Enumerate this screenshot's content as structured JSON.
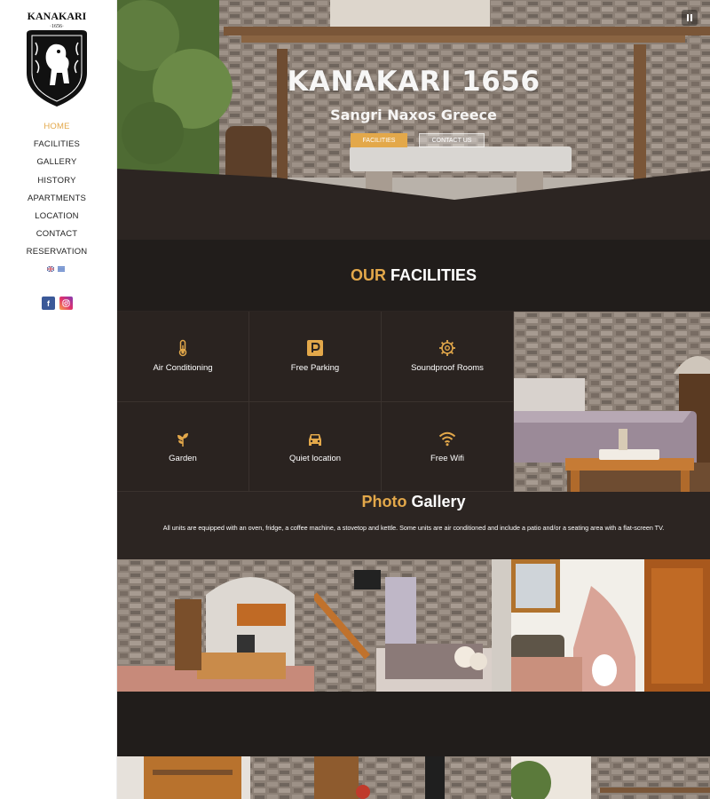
{
  "brand": {
    "logo_text": "KANAKARI",
    "logo_year": "1656"
  },
  "nav": {
    "items": [
      {
        "label": "HOME",
        "active": true
      },
      {
        "label": "FACILITIES"
      },
      {
        "label": "GALLERY"
      },
      {
        "label": "HISTORY"
      },
      {
        "label": "APARTMENTS"
      },
      {
        "label": "LOCATION"
      },
      {
        "label": "CONTACT"
      },
      {
        "label": "RESERVATION"
      }
    ]
  },
  "languages": [
    "english-flag",
    "greek-flag"
  ],
  "social": {
    "facebook": "f",
    "instagram_icon": "instagram-icon"
  },
  "hero": {
    "title": "KANAKARI 1656",
    "subtitle": "Sangri Naxos Greece",
    "button_facilities": "FACILITIES",
    "button_contact": "CONTACT US"
  },
  "facilities": {
    "title_accent": "OUR",
    "title_rest": " FACILITIES",
    "items": [
      {
        "label": "Air Conditioning",
        "icon": "thermometer-icon"
      },
      {
        "label": "Free Parking",
        "icon": "parking-icon"
      },
      {
        "label": "Soundproof Rooms",
        "icon": "gear-icon"
      },
      {
        "label": "Garden",
        "icon": "plant-icon"
      },
      {
        "label": "Quiet location",
        "icon": "car-icon"
      },
      {
        "label": "Free Wifi",
        "icon": "wifi-icon"
      }
    ]
  },
  "gallery": {
    "title_accent": "Photo",
    "title_rest": " Gallery",
    "description": "All units are equipped with an oven, fridge, a coffee machine, a stovetop and kettle. Some units are air conditioned and include a patio and/or a seating area with a flat-screen TV."
  },
  "colors": {
    "accent": "#e3a84a",
    "dark": "#2c2522",
    "darker": "#211d1b"
  }
}
